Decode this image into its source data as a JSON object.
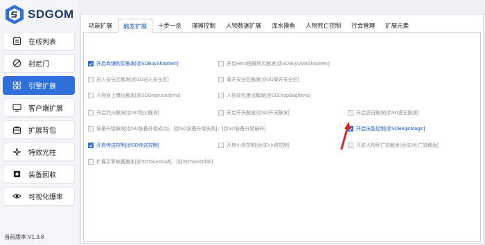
{
  "app": {
    "logo_text": "SDGOM",
    "version": "当前版本:V1.3.8"
  },
  "sidebar": {
    "items": [
      {
        "label": "在线列表",
        "icon": "list-icon",
        "active": false
      },
      {
        "label": "封尼门",
        "icon": "ban-icon",
        "active": false
      },
      {
        "label": "引擎扩展",
        "icon": "grid-icon",
        "active": true
      },
      {
        "label": "客户端扩展",
        "icon": "monitor-icon",
        "active": false
      },
      {
        "label": "扩展背包",
        "icon": "bag-icon",
        "active": false
      },
      {
        "label": "特效光柱",
        "icon": "sparkle-icon",
        "active": false
      },
      {
        "label": "装备回收",
        "icon": "recycle-icon",
        "active": false
      },
      {
        "label": "可视化爆率",
        "icon": "eye-icon",
        "active": false
      }
    ]
  },
  "tabs": [
    {
      "label": "功能扩展",
      "active": false
    },
    {
      "label": "触发扩展",
      "active": true
    },
    {
      "label": "十步一杀",
      "active": false
    },
    {
      "label": "摆摊控制",
      "active": false
    },
    {
      "label": "人物数据扩展",
      "active": false
    },
    {
      "label": "浑水摸鱼",
      "active": false
    },
    {
      "label": "人物死亡控制",
      "active": false
    },
    {
      "label": "行会管理",
      "active": false
    },
    {
      "label": "扩展元素",
      "active": false
    }
  ],
  "options": [
    {
      "label": "开启商铺购买触发[@SDBuyShopItem]",
      "checked": true
    },
    {
      "label": "开启Hero摆摊购买触发[@SDBuyUserShopItem]",
      "checked": false
    },
    {
      "label": "进入安全区触发[@SD进入安全区]",
      "checked": false
    },
    {
      "label": "离开安全区触发[@SD离开安全区]",
      "checked": false
    },
    {
      "label": "人物身上爆出触发[@SDDropUseItems]",
      "checked": false
    },
    {
      "label": "人物背包爆出触发[@SDDropBagItems]",
      "checked": false
    },
    {
      "label": "开启烈火触发[@SD烈火触发]",
      "checked": false
    },
    {
      "label": "开启开天触发[@SD开天触发]",
      "checked": false
    },
    {
      "label": "开启逐日触发[@SD逐日触发]",
      "checked": false
    },
    {
      "label": "装备升级触发[@SD装备升级成功]、[@SD装备升级失败]、[@SD装备升级破碎]",
      "checked": false
    },
    {
      "label": "开启技能控制[@SDBeginMagic]",
      "checked": true
    },
    {
      "label": "开启传送控制[@SD传送控制]",
      "checked": true
    },
    {
      "label": "开启小退控制[@SD小退控制]",
      "checked": false
    },
    {
      "label": "开启人物死亡前触发[@SD死亡前触发]",
      "checked": false
    },
    {
      "label": "扩展引擎穿戴触发[@SDTakeOnAll]、[@SDTakeOffAll]",
      "checked": false
    }
  ],
  "colors": {
    "accent": "#2f6fdc",
    "annotation_arrow": "#e02020"
  }
}
